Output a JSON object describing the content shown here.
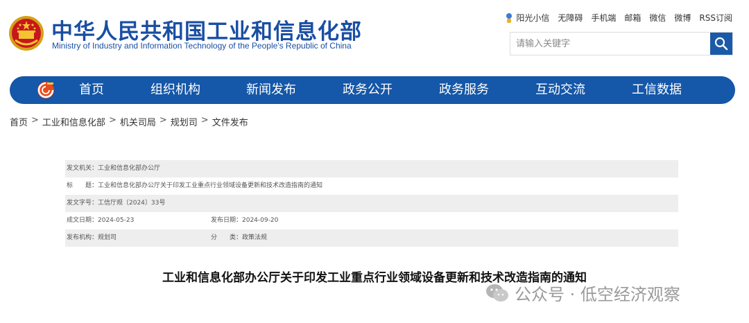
{
  "header": {
    "title": "中华人民共和国工业和信息化部",
    "subtitle": "Ministry of Industry and Information Technology of the People's Republic of China",
    "top_links": [
      "阳光小信",
      "无障碍",
      "手机端",
      "邮箱",
      "微信",
      "微博",
      "RSS订阅"
    ],
    "search_placeholder": "请输入关键字"
  },
  "nav": {
    "items": [
      "首页",
      "组织机构",
      "新闻发布",
      "政务公开",
      "政务服务",
      "互动交流",
      "工信数据"
    ]
  },
  "breadcrumb": [
    "首页",
    "工业和信息化部",
    "机关司局",
    "规划司",
    "文件发布"
  ],
  "breadcrumb_separator": ">",
  "meta": {
    "issuer": "发文机关：工业和信息化部办公厅",
    "title": "标　　题：工业和信息化部办公厅关于印发工业重点行业领域设备更新和技术改造指南的通知",
    "doc_number": "发文字号：工信厅规〔2024〕33号",
    "created_date": "成文日期：2024-05-23",
    "publish_date": "发布日期：2024-09-20",
    "publisher": "发布机构：规划司",
    "category": "分　　类：政策法规"
  },
  "article_title": "工业和信息化部办公厅关于印发工业重点行业领域设备更新和技术改造指南的通知",
  "watermark": "公众号 · 低空经济观察",
  "colors": {
    "brand_blue": "#1557a8",
    "title_blue": "#1a4ea3",
    "row_shade": "#eeeeee"
  }
}
